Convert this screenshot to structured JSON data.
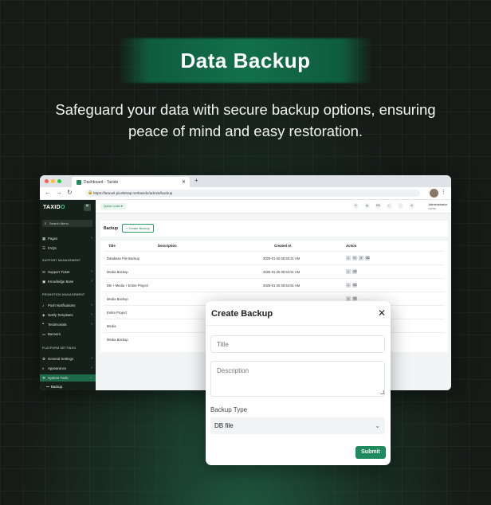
{
  "hero": {
    "title": "Data Backup",
    "subtitle_line1": "Safeguard your data with secure backup options, ensuring",
    "subtitle_line2": "peace of mind and easy restoration."
  },
  "browser": {
    "tab_title": "Dashboard - Taxido",
    "url": "https://laravel.pixelstrap.net/taxido/admin/backup"
  },
  "sidebar": {
    "logo_prefix": "TAXID",
    "logo_suffix": "O",
    "search_placeholder": "Search Menu",
    "items": [
      {
        "label": "Pages",
        "icon": "file-icon",
        "chevron": true
      },
      {
        "label": "FAQs",
        "icon": "list-icon",
        "chevron": false
      }
    ],
    "section_support": "SUPPORT MANAGEMENT",
    "support_items": [
      {
        "label": "Support Ticket",
        "chevron": true
      },
      {
        "label": "Knowledge Base",
        "chevron": true
      }
    ],
    "section_promotion": "PROMOTION MANAGEMENT",
    "promotion_items": [
      {
        "label": "Push Notifications",
        "chevron": true
      },
      {
        "label": "Notify Templates",
        "chevron": true
      },
      {
        "label": "Testimonials",
        "chevron": true
      },
      {
        "label": "Banners",
        "chevron": false
      }
    ],
    "section_platform": "PLATFORM SETTINGS",
    "platform_items": [
      {
        "label": "General Settings",
        "chevron": true
      },
      {
        "label": "Appearance",
        "chevron": true
      },
      {
        "label": "System Tools",
        "chevron": true
      }
    ],
    "sub_item": "Backup"
  },
  "topbar": {
    "quick_links": "Quick Links",
    "lang": "EN",
    "admin_name": "Administrator",
    "admin_role": "Admin"
  },
  "page": {
    "heading": "Backup",
    "create_button": "+ Create Backup",
    "columns": [
      "Title",
      "Description",
      "Created At",
      "Action"
    ],
    "rows": [
      {
        "title": "Database File Backup",
        "created": "2025-01-25 05:50:21 AM",
        "actions": 4
      },
      {
        "title": "Media Backup",
        "created": "2025-01-25 05:54:51 AM",
        "actions": 2
      },
      {
        "title": "DB + Media + Entire Project",
        "created": "2025-01-25 05:54:51 AM",
        "actions": 2
      },
      {
        "title": "Media Backup",
        "created": "",
        "actions": 2
      },
      {
        "title": "Entire Project",
        "created": "",
        "actions": 0
      },
      {
        "title": "Media",
        "created": "",
        "actions": 0
      },
      {
        "title": "Media Backup",
        "created": "",
        "actions": 0
      }
    ]
  },
  "modal": {
    "title": "Create Backup",
    "title_placeholder": "Title",
    "description_placeholder": "Description",
    "backup_type_label": "Backup Type",
    "backup_type_value": "DB file",
    "submit_label": "Submit"
  }
}
